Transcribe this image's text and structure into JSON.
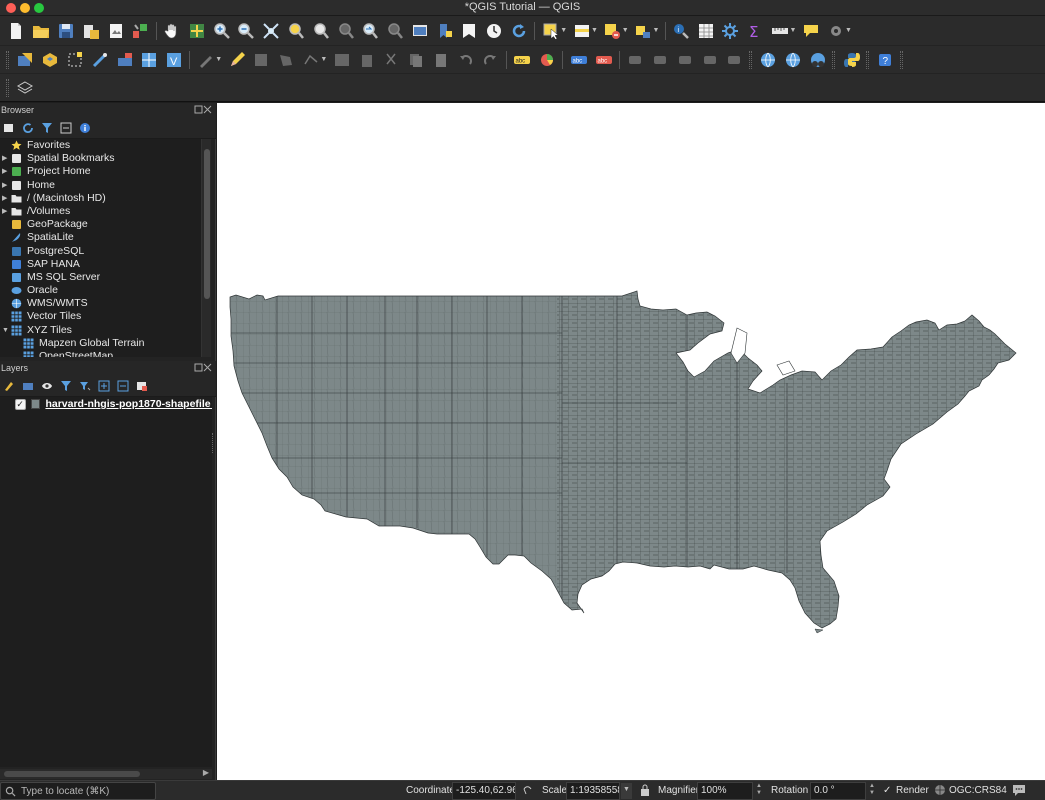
{
  "window": {
    "title": "*QGIS Tutorial — QGIS"
  },
  "toolbar1": {
    "icons": [
      "new-project",
      "open-project",
      "save-project",
      "save-as",
      "print-layout",
      "style-manager",
      "pan",
      "pan-to-selection",
      "zoom-in",
      "zoom-out",
      "zoom-full",
      "zoom-to-selection",
      "zoom-to-layer",
      "zoom-native",
      "zoom-last",
      "zoom-next",
      "new-map-view",
      "new-3d-map-view",
      "new-bookmark",
      "show-bookmarks",
      "temporal-controller",
      "refresh",
      "select-features",
      "select-by-value",
      "deselect",
      "select-location",
      "identify",
      "attribute-table",
      "field-calculator",
      "statistics",
      "measure",
      "map-tips",
      "annotation"
    ]
  },
  "toolbar2": {
    "icons": [
      "data-source-manager",
      "new-geopackage",
      "new-temp-layer",
      "digitize",
      "current-edits",
      "toggle-editing",
      "save-edits",
      "add-feature",
      "vertex-tool",
      "delete-selected",
      "cut",
      "copy",
      "paste",
      "undo",
      "redo",
      "label-tool",
      "diagram",
      "pin-labels",
      "show-hide-labels",
      "move-label",
      "rotate-label",
      "change-label",
      "metasearch",
      "add-wms",
      "georeferencer",
      "python-console",
      "help"
    ]
  },
  "browser": {
    "title": "Browser",
    "items": [
      {
        "label": "Favorites",
        "icon": "star-icon",
        "expandable": false
      },
      {
        "label": "Spatial Bookmarks",
        "icon": "bookmark-icon",
        "expandable": true
      },
      {
        "label": "Project Home",
        "icon": "project-home-icon",
        "expandable": true
      },
      {
        "label": "Home",
        "icon": "home-folder-icon",
        "expandable": true
      },
      {
        "label": "/ (Macintosh HD)",
        "icon": "folder-icon",
        "expandable": true
      },
      {
        "label": "/Volumes",
        "icon": "folder-icon",
        "expandable": true
      },
      {
        "label": "GeoPackage",
        "icon": "geopackage-icon",
        "expandable": false
      },
      {
        "label": "SpatiaLite",
        "icon": "spatialite-icon",
        "expandable": false
      },
      {
        "label": "PostgreSQL",
        "icon": "postgresql-icon",
        "expandable": false
      },
      {
        "label": "SAP HANA",
        "icon": "sap-hana-icon",
        "expandable": false
      },
      {
        "label": "MS SQL Server",
        "icon": "mssql-icon",
        "expandable": false
      },
      {
        "label": "Oracle",
        "icon": "oracle-icon",
        "expandable": false
      },
      {
        "label": "WMS/WMTS",
        "icon": "wms-icon",
        "expandable": false
      },
      {
        "label": "Vector Tiles",
        "icon": "vector-tiles-icon",
        "expandable": false
      },
      {
        "label": "XYZ Tiles",
        "icon": "xyz-tiles-icon",
        "expandable": true,
        "expanded": true
      },
      {
        "label": "Mapzen Global Terrain",
        "icon": "tile-icon",
        "child": true
      },
      {
        "label": "OpenStreetMap",
        "icon": "tile-icon",
        "child": true
      }
    ]
  },
  "layers": {
    "title": "Layers",
    "items": [
      {
        "label": "harvard-nhgis-pop1870-shapefile - ...",
        "checked": true,
        "fill_color": "#7d8889"
      }
    ]
  },
  "statusbar": {
    "locate_placeholder": "Type to locate (⌘K)",
    "coordinate_label": "Coordinate",
    "coordinate_value": "-125.40,62.96",
    "scale_label": "Scale",
    "scale_value": "1:19358558",
    "magnifier_label": "Magnifier",
    "magnifier_value": "100%",
    "rotation_label": "Rotation",
    "rotation_value": "0.0 °",
    "render_label": "Render",
    "render_checked": true,
    "crs_label": "OGC:CRS84"
  },
  "map": {
    "background_color": "#ffffff",
    "feature_fill": "#7d8889",
    "feature_stroke": "#2f3536",
    "subject": "US counties, 1870 population shapefile"
  }
}
